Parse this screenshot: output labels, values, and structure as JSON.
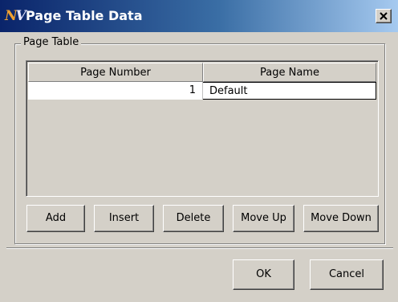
{
  "window": {
    "title": "Page Table Data"
  },
  "group": {
    "label": "Page Table"
  },
  "table": {
    "headers": [
      "Page Number",
      "Page Name"
    ],
    "rows": [
      {
        "page_number": "1",
        "page_name": "Default"
      }
    ]
  },
  "actions": {
    "add": "Add",
    "insert": "Insert",
    "delete": "Delete",
    "move_up": "Move Up",
    "move_down": "Move Down"
  },
  "footer": {
    "ok": "OK",
    "cancel": "Cancel"
  },
  "icons": {
    "app": "app-logo-icon",
    "close": "close-icon"
  },
  "colors": {
    "titlebar_start": "#0a246a",
    "titlebar_end": "#a6caf0",
    "face": "#d4d0c8"
  }
}
